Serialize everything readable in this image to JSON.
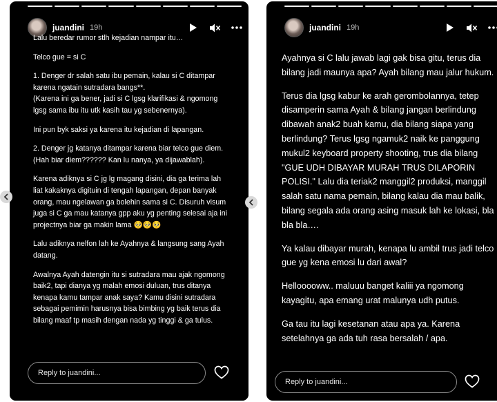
{
  "stories": [
    {
      "username": "juandini",
      "time": "19h",
      "paragraphs": [
        "Lalu beredar rumor stlh kejadian nampar itu…",
        "Telco gue = si C",
        "1. Denger dr salah satu ibu pemain, kalau  si C ditampar karena ngatain sutradara bangs**.\n(Karena ini ga bener, jadi si C lgsg klarifikasi & ngomong lgsg sama ibu itu utk kasih tau yg sebenernya).",
        "Ini pun byk saksi ya karena itu kejadian di lapangan.",
        "2. Denger jg katanya ditampar karena biar telco gue diem. (Hah biar diem?????? Kan lu nanya, ya dijawablah).",
        "Karena adiknya si C jg lg magang disini, dia ga terima lah liat kakaknya digituin di tengah lapangan, depan banyak orang, mau ngelawan ga bolehin sama si C. Disuruh visum juga si C ga mau katanya gpp aku yg penting selesai aja ini projectnya biar ga makin lama 🥺🥺🥺",
        "Lalu adiknya nelfon lah ke Ayahnya & langsung sang Ayah datang.",
        "Awalnya Ayah datengin itu si sutradara mau ajak ngomong baik2, tapi dianya yg malah emosi duluan, trus ditanya kenapa kamu tampar anak saya? Kamu disini sutradara sebagai pemimin harusnya bisa bimbing yg baik terus dia bilang maaf tp masih dengan nada yg tinggi & ga tulus."
      ],
      "reply_placeholder": "Reply to juandini..."
    },
    {
      "username": "juandini",
      "time": "19h",
      "paragraphs": [
        "Ayahnya si C lalu jawab lagi gak bisa gitu, terus dia bilang jadi maunya apa? Ayah bilang mau jalur hukum.",
        "Terus dia lgsg kabur ke arah gerombolannya, tetep disamperin sama Ayah & bilang jangan berlindung dibawah anak2 buah kamu, dia bilang siapa yang berlindung? Terus lgsg ngamuk2 naik ke panggung mukul2 keyboard property shooting, trus dia bilang \"GUE UDH DIBAYAR MURAH TRUS DILAPORIN POLISI.\" Lalu dia teriak2 manggil2 produksi, manggil salah satu nama pemain, bilang kalau dia mau balik, bilang segala ada orang asing masuk lah ke lokasi, bla bla bla….",
        "Ya kalau dibayar murah, kenapa lu ambil trus jadi telco gue yg kena emosi lu dari awal?",
        "Hellooooww.. maluuu banget kaliii ya ngomong kayagitu, apa emang urat malunya udh putus.",
        "Ga tau itu lagi kesetanan atau apa ya. Karena setelahnya ga ada tuh rasa bersalah / apa."
      ],
      "reply_placeholder": "Reply to juandini..."
    }
  ],
  "icons": {
    "play": "play-icon",
    "mute": "mute-icon",
    "more": "more-icon",
    "heart": "heart-icon",
    "prev": "chevron-left-icon"
  },
  "colors": {
    "story_bg": "#000000",
    "page_bg": "#ffffff",
    "text": "#ffffff",
    "secondary_text": "#bdbdbd"
  }
}
